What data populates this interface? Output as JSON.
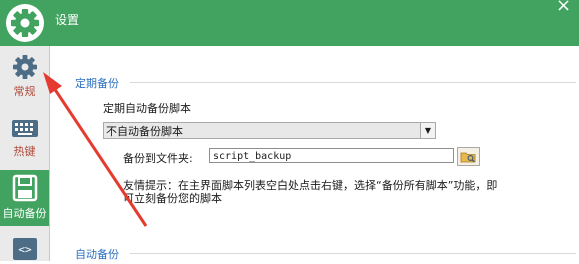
{
  "window": {
    "title": "设置"
  },
  "sidebar": {
    "items": [
      {
        "label": "常规",
        "icon": "gear-icon"
      },
      {
        "label": "热键",
        "icon": "keyboard-icon"
      },
      {
        "label": "自动备份",
        "icon": "save-icon"
      },
      {
        "label": "",
        "icon": "code-icon"
      }
    ]
  },
  "periodic_backup": {
    "section_title": "定期备份",
    "option_label": "定期自动备份脚本",
    "selected": "不自动备份脚本",
    "folder_label": "备份到文件夹:",
    "folder_value": "script_backup",
    "hint": "友情提示：在主界面脚本列表空白处点击右键，选择“备份所有脚本”功能，即可立刻备份您的脚本"
  },
  "auto_backup": {
    "section_title": "自动备份"
  },
  "colors": {
    "accent": "#41a35f",
    "section_title": "#2b6fc0",
    "annotation_arrow": "#e53a2f"
  }
}
